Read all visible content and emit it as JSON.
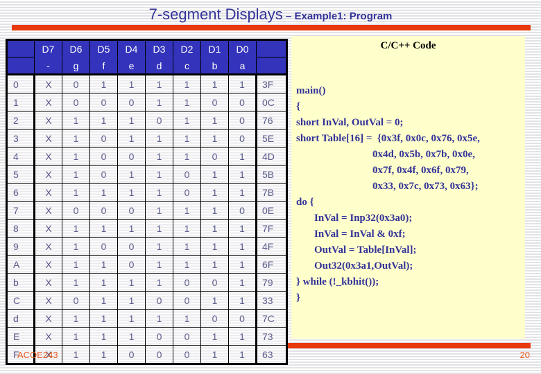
{
  "title": {
    "main": "7-segment Displays",
    "separator": " – ",
    "sub": "Example1: Program"
  },
  "colors": {
    "accent_rule": "#e8380d",
    "title_text": "#333399",
    "table_header_bg": "#3333bb",
    "code_panel_bg": "#ffffcc",
    "code_text": "#333399",
    "footer_text": "#e8591d"
  },
  "table": {
    "header_top": [
      "",
      "D7",
      "D6",
      "D5",
      "D4",
      "D3",
      "D2",
      "D1",
      "D0",
      ""
    ],
    "header_bottom": [
      "",
      "-",
      "g",
      "f",
      "e",
      "d",
      "c",
      "b",
      "a",
      ""
    ],
    "rows": [
      {
        "index": "0",
        "bits": [
          "X",
          "0",
          "1",
          "1",
          "1",
          "1",
          "1",
          "1"
        ],
        "hex": "3F"
      },
      {
        "index": "1",
        "bits": [
          "X",
          "0",
          "0",
          "0",
          "1",
          "1",
          "0",
          "0"
        ],
        "hex": "0C"
      },
      {
        "index": "2",
        "bits": [
          "X",
          "1",
          "1",
          "1",
          "0",
          "1",
          "1",
          "0"
        ],
        "hex": "76"
      },
      {
        "index": "3",
        "bits": [
          "X",
          "1",
          "0",
          "1",
          "1",
          "1",
          "1",
          "0"
        ],
        "hex": "5E"
      },
      {
        "index": "4",
        "bits": [
          "X",
          "1",
          "0",
          "0",
          "1",
          "1",
          "0",
          "1"
        ],
        "hex": "4D"
      },
      {
        "index": "5",
        "bits": [
          "X",
          "1",
          "0",
          "1",
          "1",
          "0",
          "1",
          "1"
        ],
        "hex": "5B"
      },
      {
        "index": "6",
        "bits": [
          "X",
          "1",
          "1",
          "1",
          "1",
          "0",
          "1",
          "1"
        ],
        "hex": "7B"
      },
      {
        "index": "7",
        "bits": [
          "X",
          "0",
          "0",
          "0",
          "1",
          "1",
          "1",
          "0"
        ],
        "hex": "0E"
      },
      {
        "index": "8",
        "bits": [
          "X",
          "1",
          "1",
          "1",
          "1",
          "1",
          "1",
          "1"
        ],
        "hex": "7F"
      },
      {
        "index": "9",
        "bits": [
          "X",
          "1",
          "0",
          "0",
          "1",
          "1",
          "1",
          "1"
        ],
        "hex": "4F"
      },
      {
        "index": "A",
        "bits": [
          "X",
          "1",
          "1",
          "0",
          "1",
          "1",
          "1",
          "1"
        ],
        "hex": "6F"
      },
      {
        "index": "b",
        "bits": [
          "X",
          "1",
          "1",
          "1",
          "1",
          "0",
          "0",
          "1"
        ],
        "hex": "79"
      },
      {
        "index": "C",
        "bits": [
          "X",
          "0",
          "1",
          "1",
          "0",
          "0",
          "1",
          "1"
        ],
        "hex": "33"
      },
      {
        "index": "d",
        "bits": [
          "X",
          "1",
          "1",
          "1",
          "1",
          "1",
          "0",
          "0"
        ],
        "hex": "7C"
      },
      {
        "index": "E",
        "bits": [
          "X",
          "1",
          "1",
          "1",
          "0",
          "0",
          "1",
          "1"
        ],
        "hex": "73"
      },
      {
        "index": "F",
        "bits": [
          "X",
          "1",
          "1",
          "0",
          "0",
          "0",
          "1",
          "1"
        ],
        "hex": "63"
      }
    ]
  },
  "code": {
    "heading": "C/C++ Code",
    "lines": [
      {
        "text": "main()",
        "indent": 0
      },
      {
        "text": "{",
        "indent": 0
      },
      {
        "text": "short InVal, OutVal = 0;",
        "indent": 0
      },
      {
        "text": "short Table[16] =  {0x3f, 0x0c, 0x76, 0x5e,",
        "indent": 0
      },
      {
        "text": "0x4d, 0x5b, 0x7b, 0x0e,",
        "indent": 2
      },
      {
        "text": "0x7f, 0x4f, 0x6f, 0x79,",
        "indent": 2
      },
      {
        "text": "0x33, 0x7c, 0x73, 0x63};",
        "indent": 2
      },
      {
        "text": "do {",
        "indent": 0
      },
      {
        "text": "InVal = Inp32(0x3a0);",
        "indent": 1
      },
      {
        "text": "InVal = InVal & 0xf;",
        "indent": 1
      },
      {
        "text": "OutVal = Table[InVal];",
        "indent": 1
      },
      {
        "text": "Out32(0x3a1,OutVal);",
        "indent": 1
      },
      {
        "text": "} while (!_kbhit());",
        "indent": 0
      },
      {
        "text": "}",
        "indent": 0
      }
    ]
  },
  "footer": {
    "course": "ACOE243",
    "page_number": "20"
  }
}
